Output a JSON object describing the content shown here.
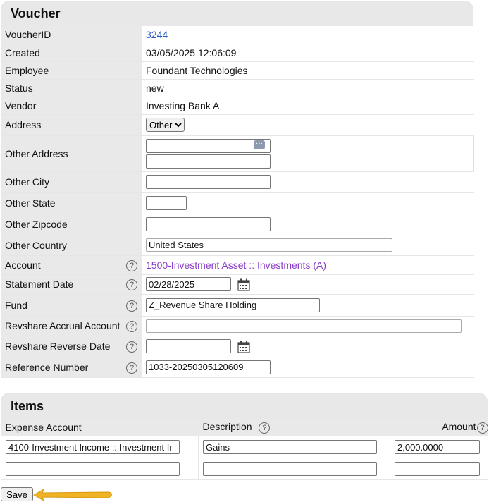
{
  "voucher": {
    "title": "Voucher",
    "voucher_id_label": "VoucherID",
    "voucher_id": "3244",
    "created_label": "Created",
    "created": "03/05/2025 12:06:09",
    "employee_label": "Employee",
    "employee": "Foundant Technologies",
    "status_label": "Status",
    "status": "new",
    "vendor_label": "Vendor",
    "vendor": "Investing Bank A",
    "address_label": "Address",
    "address_selected": "Other",
    "other_address_label": "Other Address",
    "other_address_line1": "",
    "other_address_line2": "",
    "other_city_label": "Other City",
    "other_city": "",
    "other_state_label": "Other State",
    "other_state": "",
    "other_zipcode_label": "Other Zipcode",
    "other_zipcode": "",
    "other_country_label": "Other Country",
    "other_country": "United States",
    "account_label": "Account",
    "account": "1500-Investment Asset :: Investments (A)",
    "statement_date_label": "Statement Date",
    "statement_date": "02/28/2025",
    "fund_label": "Fund",
    "fund": "Z_Revenue Share Holding",
    "revshare_accrual_label": "Revshare Accrual Account",
    "revshare_accrual": "",
    "revshare_reverse_date_label": "Revshare Reverse Date",
    "revshare_reverse_date": "",
    "reference_number_label": "Reference Number",
    "reference_number": "1033-20250305120609"
  },
  "items": {
    "title": "Items",
    "col_expense": "Expense Account",
    "col_description": "Description",
    "col_amount": "Amount",
    "rows": [
      {
        "expense": "4100-Investment Income :: Investment Ir",
        "description": "Gains",
        "amount": "2,000.0000"
      },
      {
        "expense": "",
        "description": "",
        "amount": ""
      }
    ]
  },
  "help_glyph": "?",
  "save_label": "Save",
  "colors": {
    "link": "#2b5cc4",
    "account_link": "#8a3cc8",
    "arrow": "#f0b323",
    "header_bg": "#e8e8e8"
  }
}
